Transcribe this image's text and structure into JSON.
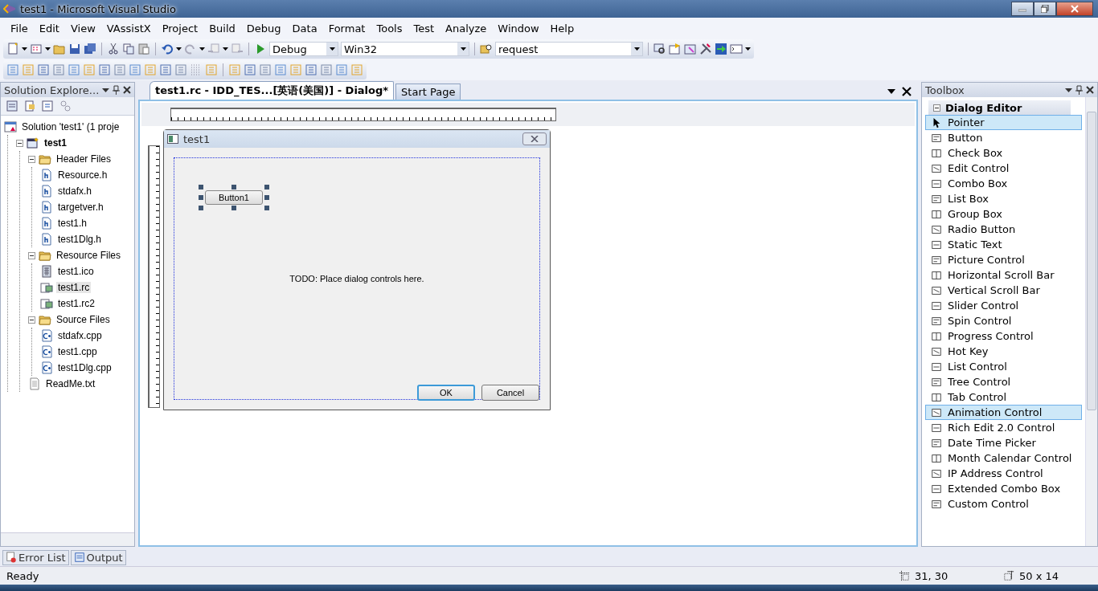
{
  "window": {
    "title": "test1 - Microsoft Visual Studio"
  },
  "menu": [
    "File",
    "Edit",
    "View",
    "VAssistX",
    "Project",
    "Build",
    "Debug",
    "Data",
    "Format",
    "Tools",
    "Test",
    "Analyze",
    "Window",
    "Help"
  ],
  "toolbar": {
    "configuration": "Debug",
    "platform": "Win32",
    "find": "request"
  },
  "solution_explorer": {
    "title": "Solution Explore...",
    "tree": [
      {
        "label": "Solution 'test1' (1 proje",
        "kind": "solution",
        "selected": false,
        "children": [
          {
            "label": "test1",
            "kind": "project",
            "selected": false,
            "expanded": true,
            "children": [
              {
                "label": "Header Files",
                "kind": "folder",
                "selected": false,
                "expanded": true,
                "children": [
                  {
                    "label": "Resource.h",
                    "kind": "header",
                    "selected": false
                  },
                  {
                    "label": "stdafx.h",
                    "kind": "header",
                    "selected": false
                  },
                  {
                    "label": "targetver.h",
                    "kind": "header",
                    "selected": false
                  },
                  {
                    "label": "test1.h",
                    "kind": "header",
                    "selected": false
                  },
                  {
                    "label": "test1Dlg.h",
                    "kind": "header",
                    "selected": false
                  }
                ]
              },
              {
                "label": "Resource Files",
                "kind": "folder",
                "selected": false,
                "expanded": true,
                "children": [
                  {
                    "label": "test1.ico",
                    "kind": "icon",
                    "selected": false
                  },
                  {
                    "label": "test1.rc",
                    "kind": "resource",
                    "selected": true
                  },
                  {
                    "label": "test1.rc2",
                    "kind": "resource",
                    "selected": false
                  }
                ]
              },
              {
                "label": "Source Files",
                "kind": "folder",
                "selected": false,
                "expanded": true,
                "children": [
                  {
                    "label": "stdafx.cpp",
                    "kind": "cpp",
                    "selected": false
                  },
                  {
                    "label": "test1.cpp",
                    "kind": "cpp",
                    "selected": false
                  },
                  {
                    "label": "test1Dlg.cpp",
                    "kind": "cpp",
                    "selected": false
                  }
                ]
              },
              {
                "label": "ReadMe.txt",
                "kind": "text",
                "selected": false
              }
            ]
          }
        ]
      }
    ]
  },
  "editor_tabs": [
    {
      "label": "test1.rc - IDD_TES...[英语(美国)] - Dialog*",
      "selected": true
    },
    {
      "label": "Start Page",
      "selected": false
    }
  ],
  "dialog": {
    "title": "test1",
    "button": "Button1",
    "todo": "TODO: Place dialog controls here.",
    "ok": "OK",
    "cancel": "Cancel"
  },
  "toolbox": {
    "title": "Toolbox",
    "group": "Dialog Editor",
    "items": [
      {
        "label": "Pointer",
        "selected": true
      },
      {
        "label": "Button",
        "selected": false
      },
      {
        "label": "Check Box",
        "selected": false
      },
      {
        "label": "Edit Control",
        "selected": false
      },
      {
        "label": "Combo Box",
        "selected": false
      },
      {
        "label": "List Box",
        "selected": false
      },
      {
        "label": "Group Box",
        "selected": false
      },
      {
        "label": "Radio Button",
        "selected": false
      },
      {
        "label": "Static Text",
        "selected": false
      },
      {
        "label": "Picture Control",
        "selected": false
      },
      {
        "label": "Horizontal Scroll Bar",
        "selected": false
      },
      {
        "label": "Vertical Scroll Bar",
        "selected": false
      },
      {
        "label": "Slider Control",
        "selected": false
      },
      {
        "label": "Spin Control",
        "selected": false
      },
      {
        "label": "Progress Control",
        "selected": false
      },
      {
        "label": "Hot Key",
        "selected": false
      },
      {
        "label": "List Control",
        "selected": false
      },
      {
        "label": "Tree Control",
        "selected": false
      },
      {
        "label": "Tab Control",
        "selected": false
      },
      {
        "label": "Animation Control",
        "selected": true
      },
      {
        "label": "Rich Edit 2.0 Control",
        "selected": false
      },
      {
        "label": "Date Time Picker",
        "selected": false
      },
      {
        "label": "Month Calendar Control",
        "selected": false
      },
      {
        "label": "IP Address Control",
        "selected": false
      },
      {
        "label": "Extended Combo Box",
        "selected": false
      },
      {
        "label": "Custom Control",
        "selected": false
      }
    ]
  },
  "bottom_tabs": [
    {
      "label": "Error List",
      "selected": false
    },
    {
      "label": "Output",
      "selected": false
    }
  ],
  "status_bar": {
    "text": "Ready",
    "position": "31, 30",
    "size": "50 x 14"
  }
}
